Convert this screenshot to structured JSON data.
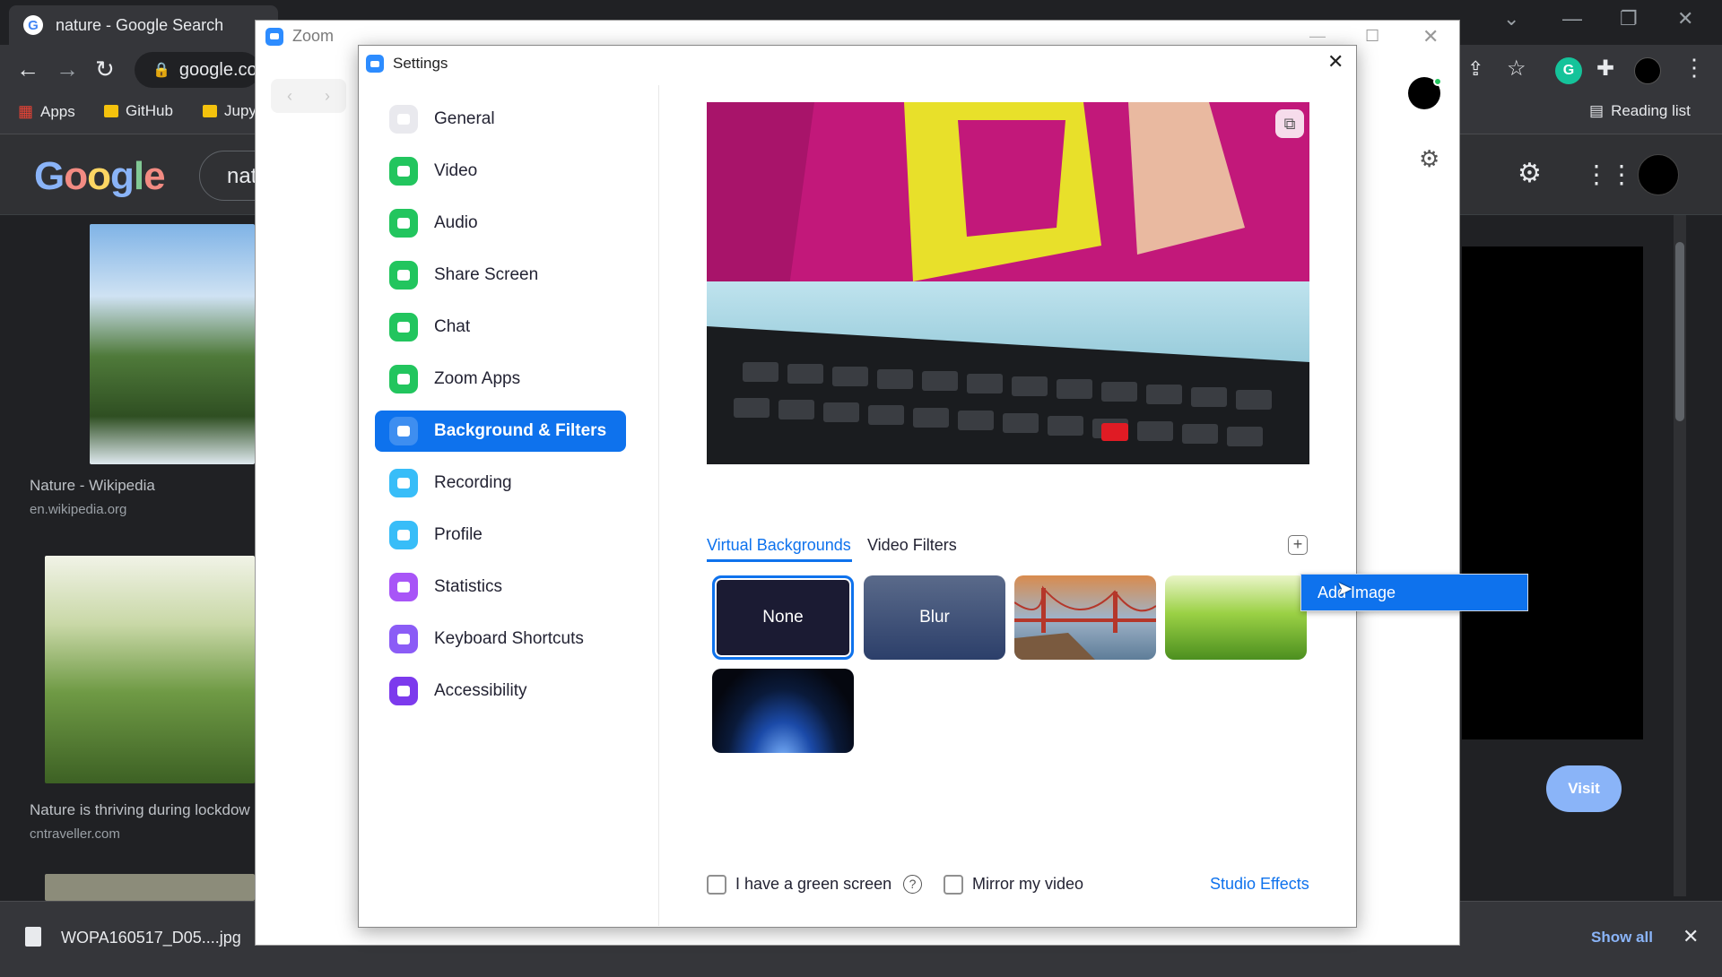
{
  "chrome": {
    "tab_title": "nature - Google Search",
    "url": "google.co",
    "bookmarks": [
      "Apps",
      "GitHub",
      "Jupy"
    ],
    "reading_list": "Reading list"
  },
  "google": {
    "search_value": "nat",
    "results": [
      {
        "title": "Nature - Wikipedia",
        "source": "en.wikipedia.org"
      },
      {
        "title": "Nature is thriving during lockdow",
        "source": "cntraveller.com"
      }
    ],
    "visit_label": "Visit"
  },
  "download": {
    "filename": "WOPA160517_D05....jpg",
    "show_all": "Show all"
  },
  "zoom": {
    "window_title": "Zoom"
  },
  "settings": {
    "title": "Settings",
    "sidebar": [
      {
        "label": "General",
        "color": "#e9e9ee"
      },
      {
        "label": "Video",
        "color": "#22c55e"
      },
      {
        "label": "Audio",
        "color": "#22c55e"
      },
      {
        "label": "Share Screen",
        "color": "#22c55e"
      },
      {
        "label": "Chat",
        "color": "#22c55e"
      },
      {
        "label": "Zoom Apps",
        "color": "#22c55e"
      },
      {
        "label": "Background & Filters",
        "color": "#0e72ed"
      },
      {
        "label": "Recording",
        "color": "#38bdf8"
      },
      {
        "label": "Profile",
        "color": "#38bdf8"
      },
      {
        "label": "Statistics",
        "color": "#a855f7"
      },
      {
        "label": "Keyboard Shortcuts",
        "color": "#8b5cf6"
      },
      {
        "label": "Accessibility",
        "color": "#7c3aed"
      }
    ],
    "tabs": {
      "virtual_backgrounds": "Virtual Backgrounds",
      "video_filters": "Video Filters"
    },
    "backgrounds": [
      "None",
      "Blur"
    ],
    "context_menu_item": "Add Image",
    "green_screen_label": "I have a green screen",
    "mirror_label": "Mirror my video",
    "studio_effects": "Studio Effects"
  }
}
